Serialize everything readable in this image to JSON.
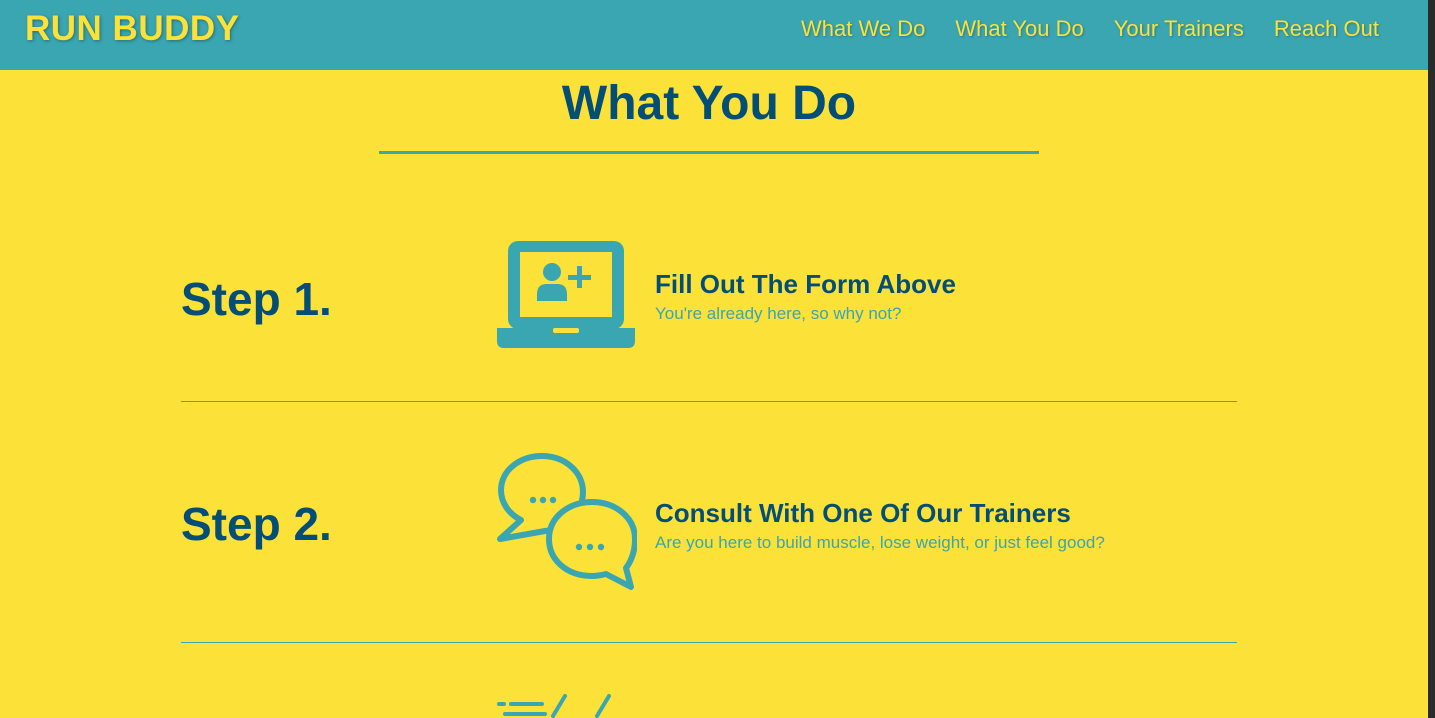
{
  "header": {
    "logo": "RUN BUDDY",
    "nav": [
      "What We Do",
      "What You Do",
      "Your Trainers",
      "Reach Out"
    ]
  },
  "section": {
    "title": "What You Do"
  },
  "steps": [
    {
      "label": "Step 1.",
      "icon": "laptop-add-user-icon",
      "heading": "Fill Out The Form Above",
      "description": "You're already here, so why not?"
    },
    {
      "label": "Step 2.",
      "icon": "chat-bubbles-icon",
      "heading": "Consult With One Of Our Trainers",
      "description": "Are you here to build muscle, lose weight, or just feel good?"
    },
    {
      "icon": "running-speed-icon"
    }
  ],
  "colors": {
    "background": "#fce138",
    "header": "#39a6b2",
    "heading_text": "#024e76",
    "accent": "#39a6b2"
  }
}
